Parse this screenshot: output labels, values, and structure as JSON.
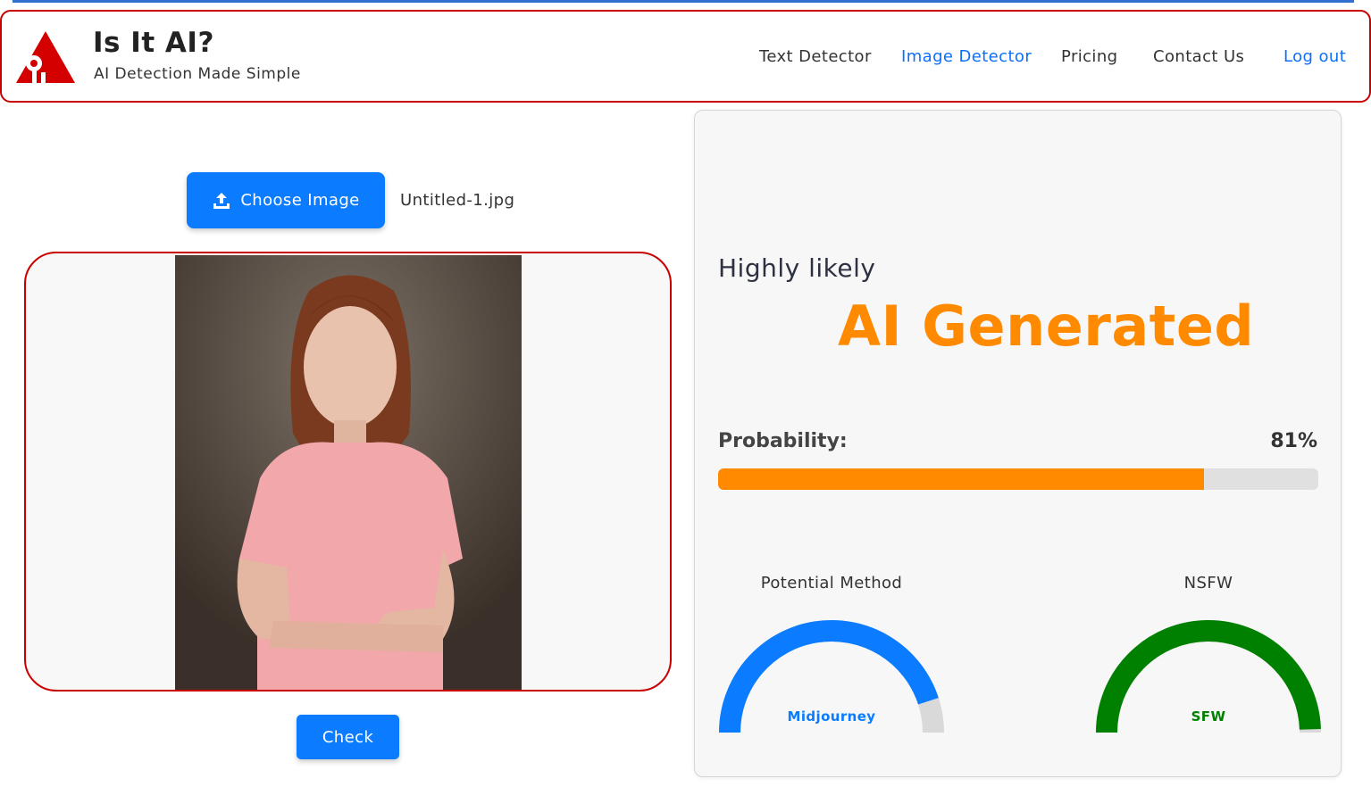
{
  "brand": {
    "title": "Is It AI?",
    "tagline": "AI Detection Made Simple"
  },
  "nav": [
    {
      "label": "Text Detector",
      "active": false
    },
    {
      "label": "Image Detector",
      "active": true
    },
    {
      "label": "Pricing",
      "active": false
    },
    {
      "label": "Contact Us",
      "active": false
    },
    {
      "label": "Log out",
      "active": false
    }
  ],
  "upload": {
    "button_label": "Choose Image",
    "file_name": "Untitled-1.jpg"
  },
  "check_label": "Check",
  "result": {
    "likelihood": "Highly likely",
    "verdict": "AI Generated",
    "probability_label": "Probability:",
    "probability_value": "81%",
    "probability": 0.81
  },
  "gauges": {
    "method": {
      "title": "Potential Method",
      "value_label": "Midjourney",
      "level": 0.9,
      "color": "#0b7cff"
    },
    "nsfw": {
      "title": "NSFW",
      "value_label": "SFW",
      "level": 0.99,
      "color": "#008000"
    }
  },
  "colors": {
    "accent": "#0b7cff",
    "brand_red": "#c80000",
    "verdict": "#ff8a00",
    "track": "#d9d9d9"
  }
}
